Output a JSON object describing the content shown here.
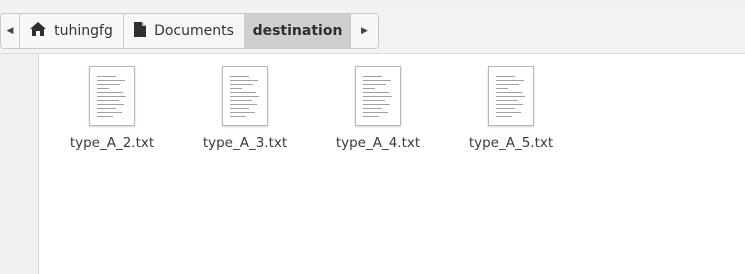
{
  "pathbar": {
    "crumbs": [
      {
        "label": "tuhingfg",
        "icon": "home-icon"
      },
      {
        "label": "Documents",
        "icon": "document-folder-icon"
      },
      {
        "label": "destination",
        "icon": ""
      }
    ],
    "prev_icon": "chevron-left-icon",
    "next_icon": "chevron-right-icon"
  },
  "files": [
    {
      "name": "type_A_2.txt",
      "icon": "text-file-icon"
    },
    {
      "name": "type_A_3.txt",
      "icon": "text-file-icon"
    },
    {
      "name": "type_A_4.txt",
      "icon": "text-file-icon"
    },
    {
      "name": "type_A_5.txt",
      "icon": "text-file-icon"
    }
  ],
  "colors": {
    "active_crumb": "#cfcfcf",
    "toolbar": "#f2f2f2",
    "sidebar": "#f0f0f0"
  }
}
